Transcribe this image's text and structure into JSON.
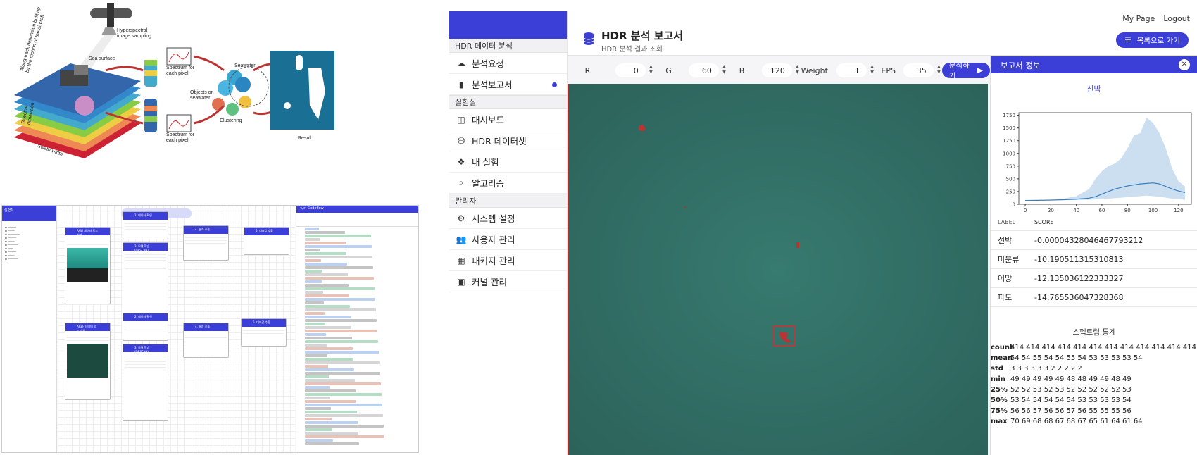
{
  "diagram": {
    "labels": {
      "aircraft": "Hyperspectral\nimage sampling",
      "sea_surface": "Sea surface",
      "along_track": "Along-track dimension built up\nby the motion of the aircraft",
      "spectral_dim": "Spectral\ndimension",
      "swath": "Swath width",
      "spectrum1": "Spectrum for\neach pixel",
      "spectrum2": "Spectrum for\neach pixel",
      "seawater": "Seawater",
      "objects": "Objects on\nseawater",
      "clustering": "Clustering",
      "result": "Result"
    }
  },
  "editor": {
    "title": "실험1",
    "code_title": "</> Codeflow",
    "nodes": [
      {
        "label": "RAW 데이터 로드 실험"
      },
      {
        "label": "2. 데이터 확인"
      },
      {
        "label": "3. 모델 학습 (DBSCAN)"
      },
      {
        "label": "4. 결과 추출"
      },
      {
        "label": "5. 대표값 추출"
      },
      {
        "label": "ARBF 데이터 로드 실험"
      },
      {
        "label": "2. 데이터 확인"
      },
      {
        "label": "3. 모델 학습 (DBSCAN)"
      },
      {
        "label": "4. 결과 추출"
      },
      {
        "label": "5. 대표값 추출"
      }
    ]
  },
  "app": {
    "sidebar": {
      "sections": [
        {
          "title": "HDR 데이터 분석",
          "items": [
            {
              "label": "분석요청",
              "icon": "cloud-upload-icon"
            },
            {
              "label": "분석보고서",
              "icon": "book-icon",
              "active": true
            }
          ]
        },
        {
          "title": "실험실",
          "items": [
            {
              "label": "대시보드",
              "icon": "columns-icon"
            },
            {
              "label": "HDR 데이터셋",
              "icon": "database-icon"
            },
            {
              "label": "내 실험",
              "icon": "cubes-icon"
            },
            {
              "label": "알고리즘",
              "icon": "search-icon"
            }
          ]
        },
        {
          "title": "관리자",
          "items": [
            {
              "label": "시스템 설정",
              "icon": "cogs-icon"
            },
            {
              "label": "사용자 관리",
              "icon": "users-icon"
            },
            {
              "label": "패키지 관리",
              "icon": "package-icon"
            },
            {
              "label": "커널 관리",
              "icon": "microchip-icon"
            }
          ]
        }
      ]
    },
    "header": {
      "title": "HDR 분석 보고서",
      "subtitle": "HDR 분석 결과 조회",
      "links": [
        "My Page",
        "Logout"
      ],
      "back_button": "목록으로 가기"
    },
    "params": [
      {
        "label": "R",
        "value": "0"
      },
      {
        "label": "G",
        "value": "60"
      },
      {
        "label": "B",
        "value": "120"
      },
      {
        "label": "Weight",
        "value": "1"
      },
      {
        "label": "EPS",
        "value": "35"
      }
    ],
    "run_button": "분석하기",
    "panel": {
      "title": "보고서 정보",
      "selected": "선박",
      "table_headers": [
        "LABEL",
        "SCORE"
      ],
      "rows": [
        {
          "label": "선박",
          "score": "-0.00004328046467793212"
        },
        {
          "label": "미분류",
          "score": "-10.190511315310813"
        },
        {
          "label": "어망",
          "score": "-12.135036122333327"
        },
        {
          "label": "파도",
          "score": "-14.765536047328368"
        }
      ],
      "stats_title": "스펙트럼 통계",
      "stats": [
        {
          "key": "count",
          "values": "414 414 414 414 414 414 414 414 414 414 414 414 414 414 41"
        },
        {
          "key": "mean",
          "values": "54  54  55  54  54  55  54  53  53  53  53  54"
        },
        {
          "key": "std",
          "values": "3    3    3    3    3    3    2    2    2    2    2"
        },
        {
          "key": "min",
          "values": "49  49  49  49  49  48  48  49  49  48  49"
        },
        {
          "key": "25%",
          "values": "52  52  53  52  53  52  52  52  52  52  53"
        },
        {
          "key": "50%",
          "values": "53  54  54  54  54  54  53  53  53  53  54"
        },
        {
          "key": "75%",
          "values": "56  56  57  56  56  57  56  55  55  55  56"
        },
        {
          "key": "max",
          "values": "70  69  68  68  67  68  67  65  61  64  61  64"
        }
      ]
    }
  },
  "chart_data": {
    "type": "area",
    "x": [
      0,
      10,
      20,
      30,
      40,
      50,
      55,
      60,
      65,
      70,
      75,
      80,
      85,
      90,
      95,
      100,
      105,
      110,
      115,
      120,
      125
    ],
    "series": [
      {
        "values": [
          75,
          78,
          82,
          90,
          100,
          120,
          150,
          200,
          250,
          300,
          330,
          360,
          380,
          400,
          410,
          420,
          400,
          350,
          300,
          260,
          230
        ]
      }
    ],
    "band_upper": [
      80,
      85,
      95,
      110,
      160,
      300,
      500,
      650,
      750,
      800,
      900,
      1100,
      1350,
      1400,
      1700,
      1600,
      1400,
      1100,
      700,
      450,
      350
    ],
    "band_lower": [
      70,
      72,
      75,
      80,
      85,
      90,
      95,
      100,
      110,
      120,
      130,
      140,
      150,
      160,
      170,
      160,
      150,
      130,
      110,
      100,
      90
    ],
    "xlim": [
      -5,
      130
    ],
    "ylim": [
      0,
      1800
    ],
    "xticks": [
      0,
      20,
      40,
      60,
      80,
      100,
      120
    ],
    "yticks": [
      0,
      250,
      500,
      750,
      1000,
      1250,
      1500,
      1750
    ]
  }
}
